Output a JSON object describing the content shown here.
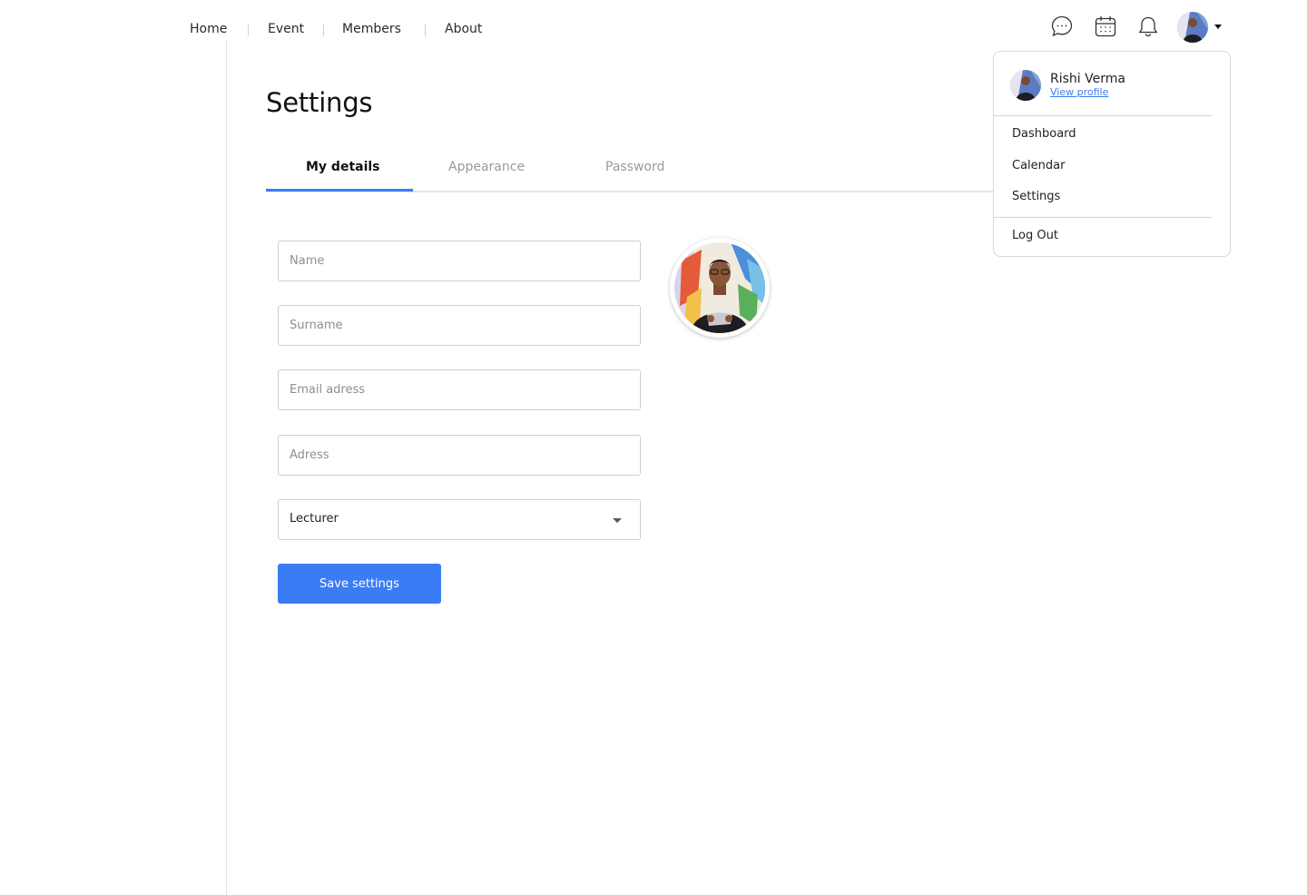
{
  "nav": {
    "items": [
      {
        "label": "Home"
      },
      {
        "label": "Event"
      },
      {
        "label": "Members"
      },
      {
        "label": "About"
      }
    ]
  },
  "header": {
    "icons": [
      "chat-icon",
      "calendar-icon",
      "bell-icon"
    ],
    "avatar_icon": "user-avatar",
    "caret_icon": "chevron-down-icon"
  },
  "page": {
    "title": "Settings"
  },
  "tabs": [
    {
      "label": "My details",
      "active": true
    },
    {
      "label": "Appearance",
      "active": false
    },
    {
      "label": "Password",
      "active": false
    }
  ],
  "form": {
    "name_placeholder": "Name",
    "surname_placeholder": "Surname",
    "email_placeholder": "Email adress",
    "address_placeholder": "Adress",
    "role_value": "Lecturer",
    "save_label": "Save settings"
  },
  "dropdown": {
    "user_name": "Rishi Verma",
    "view_profile_label": "View profile",
    "items": [
      {
        "label": "Dashboard"
      },
      {
        "label": "Calendar"
      },
      {
        "label": "Settings"
      }
    ],
    "logout_label": "Log Out"
  },
  "colors": {
    "accent": "#3b7cf5",
    "border": "#cfcfcf",
    "muted_text": "#9a9a9a"
  }
}
